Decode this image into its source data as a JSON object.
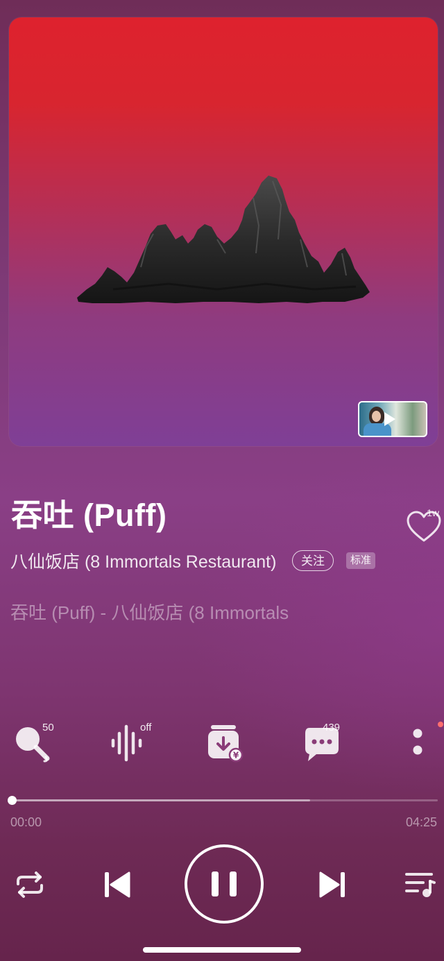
{
  "song": {
    "title": "吞吐 (Puff)",
    "artist": "八仙饭店 (8 Immortals Restaurant)",
    "like_count": "1w",
    "follow_label": "关注",
    "quality_label": "标准"
  },
  "lyrics": {
    "current_line": "吞吐 (Puff) - 八仙饭店 (8 Immortals"
  },
  "actions": {
    "karaoke_count": "50",
    "sound_effect_state": "off",
    "comments_count": "439"
  },
  "playback": {
    "current_time": "00:00",
    "total_time": "04:25",
    "progress_fraction": 0.0,
    "buffered_fraction": 0.7,
    "state": "playing"
  },
  "icons": {
    "repeat": "repeat-icon",
    "previous": "previous-track-icon",
    "pause": "pause-icon",
    "next": "next-track-icon",
    "playlist": "playlist-icon",
    "karaoke": "microphone-icon",
    "sound_effect": "sound-wave-icon",
    "download": "download-icon",
    "comments": "comment-icon",
    "more": "more-vertical-icon",
    "like": "heart-icon"
  },
  "colors": {
    "artwork_top": "#de222e",
    "artwork_bottom": "#7f3f96",
    "background_mid": "#8a3f86"
  }
}
